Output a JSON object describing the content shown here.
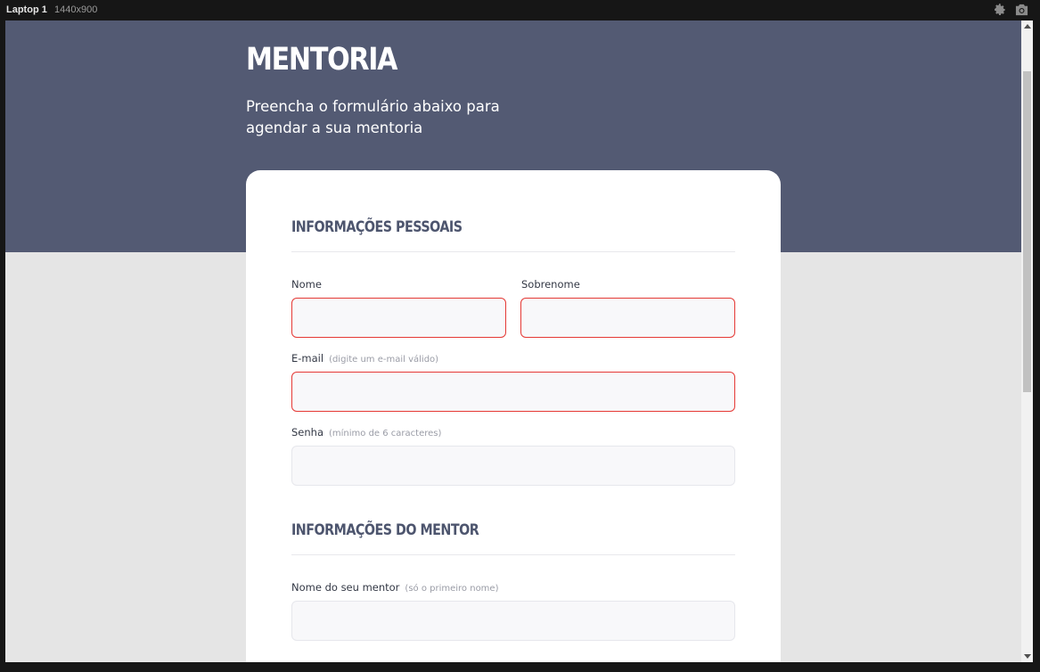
{
  "devtools": {
    "device_name": "Laptop 1",
    "device_size": "1440x900"
  },
  "header": {
    "brand": "MENTORIA",
    "subtitle": "Preencha o formulário abaixo para agendar a sua mentoria"
  },
  "form": {
    "personal_section": {
      "title": "INFORMAÇÕES PESSOAIS",
      "first_name": {
        "label": "Nome",
        "value": "",
        "invalid": true
      },
      "last_name": {
        "label": "Sobrenome",
        "value": "",
        "invalid": true
      },
      "email": {
        "label": "E-mail",
        "hint": "(digite um e-mail válido)",
        "value": "",
        "invalid": true
      },
      "password": {
        "label": "Senha",
        "hint": "(mínimo de 6 caracteres)",
        "value": "",
        "invalid": false
      }
    },
    "mentor_section": {
      "title": "INFORMAÇÕES DO MENTOR",
      "mentor_name": {
        "label": "Nome do seu mentor",
        "hint": "(só o primeiro nome)",
        "value": "",
        "invalid": false
      }
    }
  },
  "colors": {
    "hero_bg": "#535a73",
    "page_bg": "#e5e5e5",
    "invalid_border": "#e53935",
    "section_title": "#4d556e"
  },
  "icons": {
    "settings": "gear-icon",
    "screenshot": "camera-icon"
  }
}
